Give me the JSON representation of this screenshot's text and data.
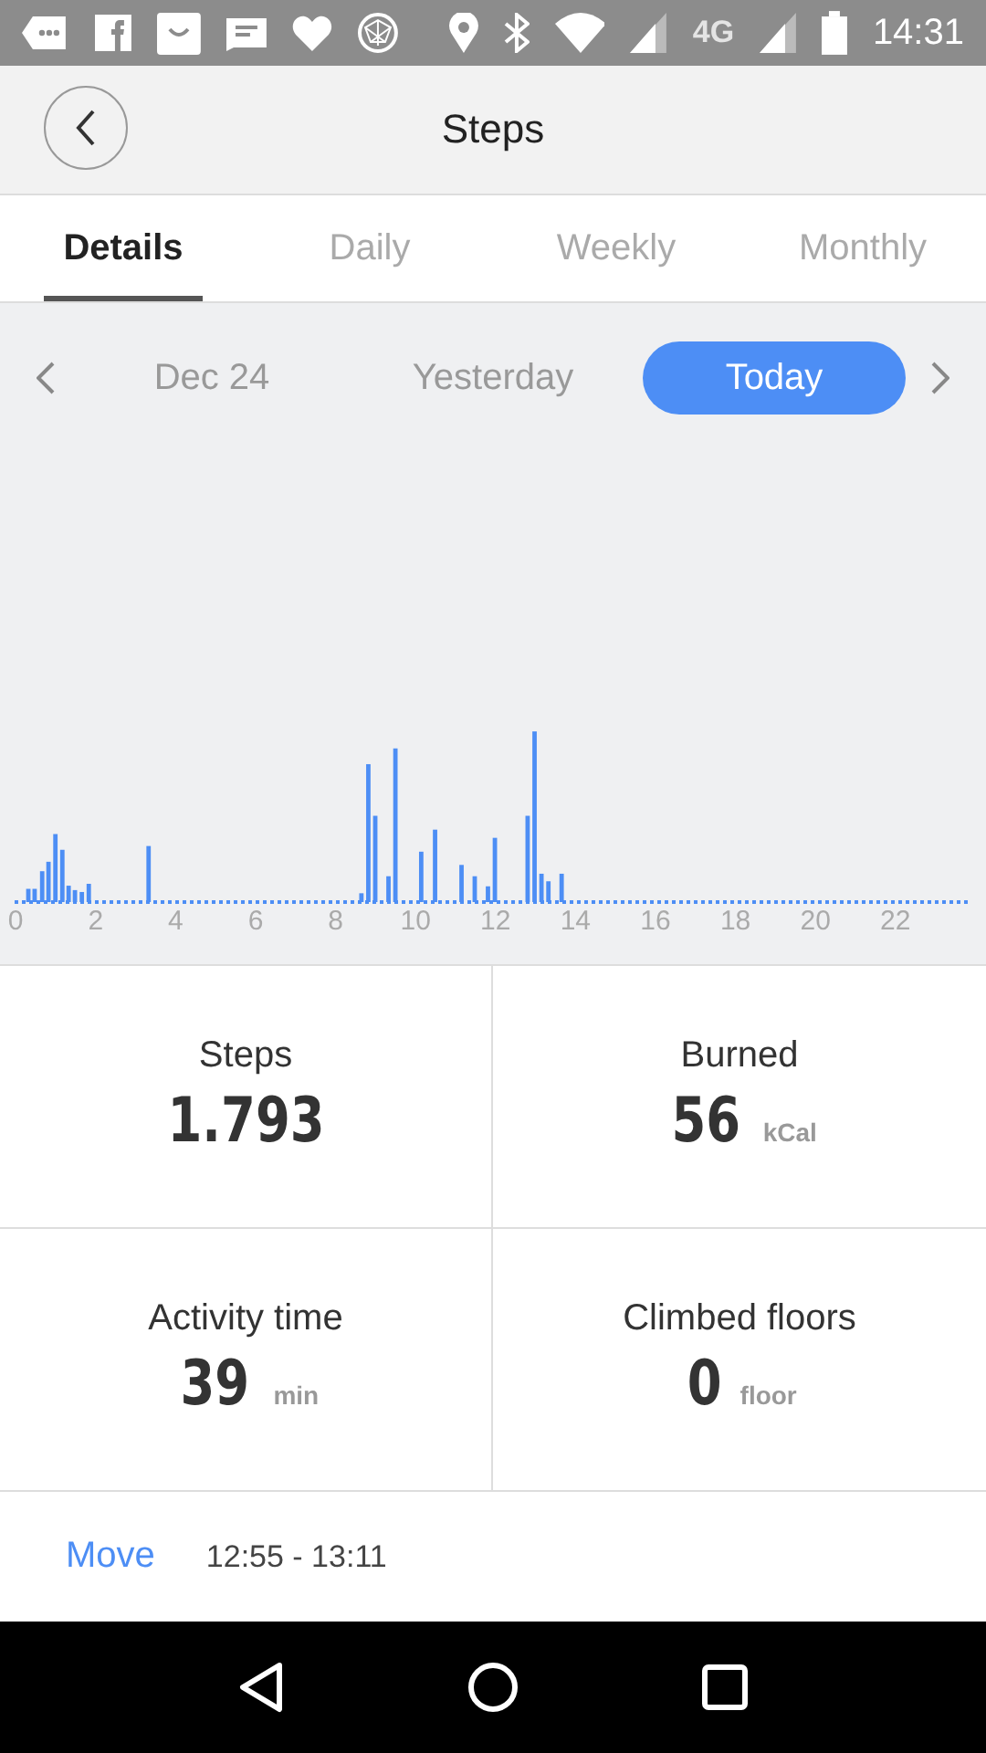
{
  "status_bar": {
    "network": "4G",
    "time": "14:31"
  },
  "header": {
    "title": "Steps"
  },
  "tabs": [
    {
      "label": "Details",
      "selected": true
    },
    {
      "label": "Daily",
      "selected": false
    },
    {
      "label": "Weekly",
      "selected": false
    },
    {
      "label": "Monthly",
      "selected": false
    }
  ],
  "dates": [
    {
      "label": "Dec 24",
      "selected": false
    },
    {
      "label": "Yesterday",
      "selected": false
    },
    {
      "label": "Today",
      "selected": true
    }
  ],
  "chart": {
    "axis_labels": [
      "0",
      "2",
      "4",
      "6",
      "8",
      "10",
      "12",
      "14",
      "16",
      "18",
      "20",
      "22"
    ]
  },
  "stats": [
    {
      "label": "Steps",
      "value": "1.793"
    },
    {
      "label": "Burned",
      "value": "56",
      "unit": "kCal"
    },
    {
      "label": "Activity time",
      "value": "39",
      "unit": "min"
    },
    {
      "label": "Climbed floors",
      "value": "0",
      "unit": "floor"
    }
  ],
  "activity": {
    "type": "Move",
    "time_range": "12:55 - 13:11"
  }
}
